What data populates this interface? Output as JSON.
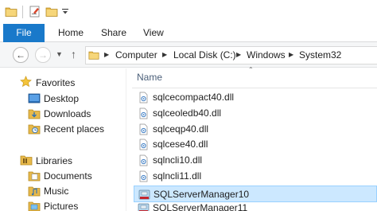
{
  "ribbon": {
    "file_label": "File",
    "home_label": "Home",
    "share_label": "Share",
    "view_label": "View"
  },
  "address": {
    "crumbs": [
      "Computer",
      "Local Disk (C:)",
      "Windows",
      "System32"
    ]
  },
  "sidebar": {
    "favorites": {
      "label": "Favorites",
      "items": [
        "Desktop",
        "Downloads",
        "Recent places"
      ]
    },
    "libraries": {
      "label": "Libraries",
      "items": [
        "Documents",
        "Music",
        "Pictures"
      ]
    }
  },
  "content": {
    "column_name": "Name",
    "files": [
      {
        "name": "sqlcecompact40.dll",
        "icon": "dll-file-icon"
      },
      {
        "name": "sqlceoledb40.dll",
        "icon": "dll-file-icon"
      },
      {
        "name": "sqlceqp40.dll",
        "icon": "dll-file-icon"
      },
      {
        "name": "sqlcese40.dll",
        "icon": "dll-file-icon"
      },
      {
        "name": "sqlncli10.dll",
        "icon": "dll-file-icon"
      },
      {
        "name": "sqlncli11.dll",
        "icon": "dll-file-icon"
      },
      {
        "name": "SQLServerManager10",
        "icon": "sql-server-manager-icon",
        "selected": true
      },
      {
        "name": "SQLServerManager11",
        "icon": "sql-server-manager-icon"
      }
    ]
  },
  "colors": {
    "accent": "#1979ca",
    "selection": "#cce8ff",
    "folder": "#e8b94a"
  }
}
